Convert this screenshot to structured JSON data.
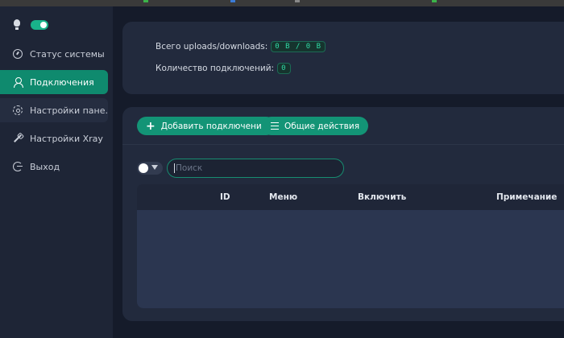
{
  "sidebar": {
    "theme_toggle_on": true,
    "items": [
      {
        "label": "Статус системы",
        "icon": "dashboard-icon",
        "active": false
      },
      {
        "label": "Подключения",
        "icon": "user-icon",
        "active": true
      },
      {
        "label": "Настройки пане...",
        "icon": "gear-icon",
        "active": false
      },
      {
        "label": "Настройки Xray",
        "icon": "tool-icon",
        "active": false
      },
      {
        "label": "Выход",
        "icon": "logout-icon",
        "active": false
      }
    ]
  },
  "stats": {
    "total_label": "Всего uploads/downloads:",
    "total_value": "0 B / 0 B",
    "count_label": "Количество подключений:",
    "count_value": "0"
  },
  "toolbar": {
    "add_label": "Добавить подключение",
    "actions_label": "Общие действия"
  },
  "search": {
    "placeholder": "Поиск",
    "value": ""
  },
  "table": {
    "columns": [
      "ID",
      "Меню",
      "Включить",
      "Примечание"
    ]
  },
  "colors": {
    "accent": "#139476",
    "sidebar_active": "#0f8a6e",
    "tag_text": "#30d9a5"
  }
}
